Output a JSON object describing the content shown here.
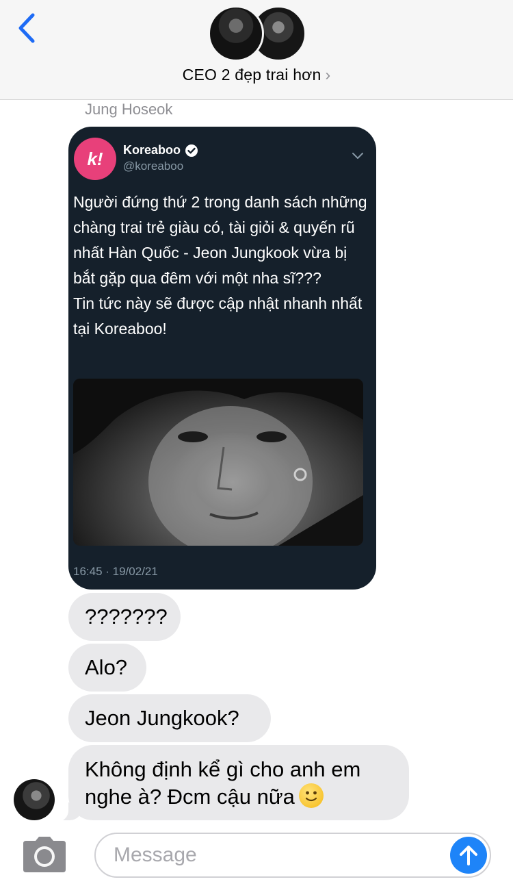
{
  "header": {
    "title": "CEO 2 đẹp trai hơn",
    "chevron": "›",
    "accent_color": "#1e6bf5"
  },
  "thread": {
    "sender_name": "Jung Hoseok",
    "tweet": {
      "account_name": "Koreaboo",
      "handle": "@koreaboo",
      "logo_text": "k!",
      "brand_color": "#e8407a",
      "body": "Người đứng thứ 2 trong danh sách những chàng trai trẻ giàu có, tài giỏi & quyến rũ nhất Hàn Quốc - Jeon Jungkook vừa bị bắt gặp qua đêm với một nha sĩ???\nTin tức này sẽ được cập nhật nhanh nhất tại Koreaboo!",
      "timestamp": "16:45 · 19/02/21"
    },
    "messages": [
      {
        "text": "???????"
      },
      {
        "text": "Alo?"
      },
      {
        "text": "Jeon Jungkook?"
      },
      {
        "text": "Không định kể gì cho anh em\nnghe à? Đcm cậu nữa"
      }
    ]
  },
  "composer": {
    "placeholder": "Message",
    "send_color": "#1e84f8"
  }
}
